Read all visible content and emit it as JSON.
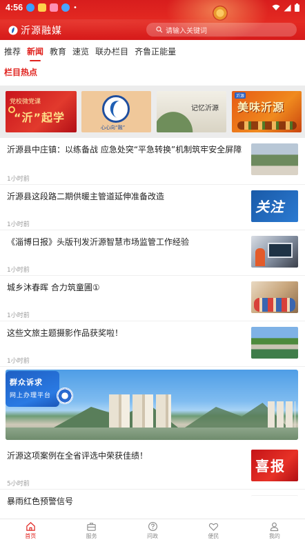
{
  "status_bar": {
    "time": "4:56"
  },
  "header": {
    "app_name": "沂源融媒",
    "search_placeholder": "请输入关键词"
  },
  "tabs": [
    {
      "label": "推荐",
      "active": false
    },
    {
      "label": "新闻",
      "active": true
    },
    {
      "label": "教育",
      "active": false
    },
    {
      "label": "速览",
      "active": false
    },
    {
      "label": "联办栏目",
      "active": false
    },
    {
      "label": "齐鲁正能量",
      "active": false
    }
  ],
  "section_title": "栏目热点",
  "banners": [
    {
      "line1": "党校微党课",
      "line2": "“沂”起学"
    },
    {
      "line1": "心心向“融”"
    },
    {
      "line1": "记忆沂源"
    },
    {
      "line1": "美味沂源",
      "tag": "沂源"
    }
  ],
  "news": [
    {
      "title": "沂源县中庄镇：以练备战  应急处突“平急转换”机制筑牢安全屏障",
      "time": "1小时前"
    },
    {
      "title": "沂源县这段路二期供暖主管道延伸准备改造",
      "time": "1小时前",
      "thumb_text": "关注"
    },
    {
      "title": "《淄博日报》头版刊发沂源智慧市场监管工作经验",
      "time": "1小时前"
    },
    {
      "title": "城乡沐春晖  合力筑童圃①",
      "time": "1小时前"
    },
    {
      "title": "这些文旅主题摄影作品获奖啦！",
      "time": "1小时前"
    },
    {
      "title": "沂源这项案例在全省评选中荣获佳绩！",
      "time": "5小时前",
      "thumb_text": "喜报"
    },
    {
      "title": "暴雨红色预警信号",
      "time": ""
    }
  ],
  "promo": {
    "line1": "群众诉求",
    "line2": "网上办理平台"
  },
  "bottom_nav": [
    {
      "label": "首页",
      "icon": "home-icon",
      "active": true
    },
    {
      "label": "服务",
      "icon": "briefcase-icon",
      "active": false
    },
    {
      "label": "问政",
      "icon": "question-icon",
      "active": false
    },
    {
      "label": "便民",
      "icon": "heart-icon",
      "active": false
    },
    {
      "label": "我的",
      "icon": "user-icon",
      "active": false
    }
  ],
  "colors": {
    "brand_red": "#e0221e",
    "header_red": "#d81d1d",
    "muted": "#9a9a9a"
  }
}
